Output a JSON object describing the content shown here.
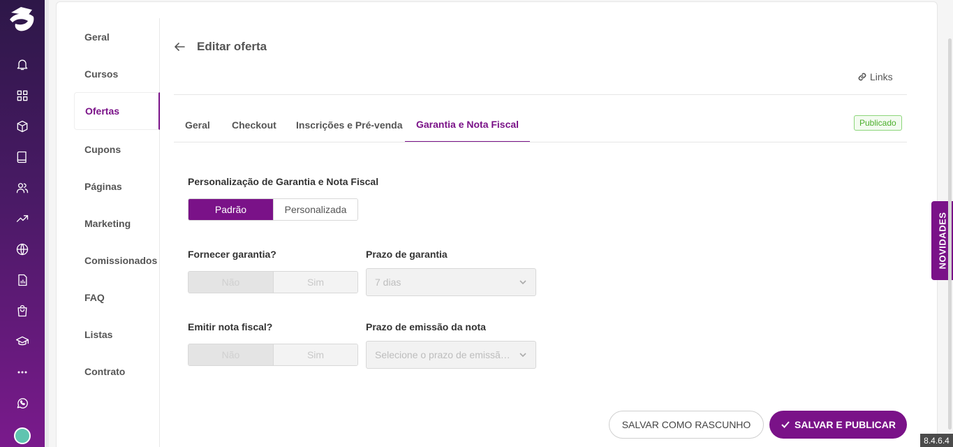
{
  "rail": {
    "icons": [
      "bell-icon",
      "dashboard-icon",
      "box-icon",
      "book-icon",
      "users-icon",
      "trending-up-icon",
      "globe-icon",
      "report-icon",
      "shopping-bag-icon",
      "graduation-cap-icon",
      "more-icon",
      "whatsapp-icon"
    ]
  },
  "menu": {
    "items": [
      {
        "label": "Geral"
      },
      {
        "label": "Cursos"
      },
      {
        "label": "Ofertas"
      },
      {
        "label": "Cupons"
      },
      {
        "label": "Páginas"
      },
      {
        "label": "Marketing"
      },
      {
        "label": "Comissionados"
      },
      {
        "label": "FAQ"
      },
      {
        "label": "Listas"
      },
      {
        "label": "Contrato"
      }
    ],
    "active": "Ofertas"
  },
  "header": {
    "title": "Editar oferta",
    "links_label": "Links"
  },
  "tabs": [
    {
      "label": "Geral"
    },
    {
      "label": "Checkout"
    },
    {
      "label": "Inscrições e Pré-venda"
    },
    {
      "label": "Garantia e Nota Fiscal"
    }
  ],
  "active_tab": "Garantia e Nota Fiscal",
  "status_badge": "Publicado",
  "form": {
    "personalization_label": "Personalização de Garantia e Nota Fiscal",
    "personalization_options": [
      "Padrão",
      "Personalizada"
    ],
    "personalization_selected": "Padrão",
    "warranty_label": "Fornecer garantia?",
    "warranty_options": [
      "Não",
      "Sim"
    ],
    "warranty_selected": "Não",
    "warranty_period_label": "Prazo de garantia",
    "warranty_period_value": "7 dias",
    "invoice_label": "Emitir nota fiscal?",
    "invoice_options": [
      "Não",
      "Sim"
    ],
    "invoice_selected": "Não",
    "invoice_period_label": "Prazo de emissão da nota",
    "invoice_period_placeholder": "Selecione o prazo de emissão da nota"
  },
  "actions": {
    "draft_label": "SALVAR COMO RASCUNHO",
    "publish_label": "SALVAR E PUBLICAR"
  },
  "novidades_label": "NOVIDADES",
  "version": "8.4.6.4",
  "colors": {
    "accent": "#7a1288",
    "published_green": "#4caf2c"
  }
}
